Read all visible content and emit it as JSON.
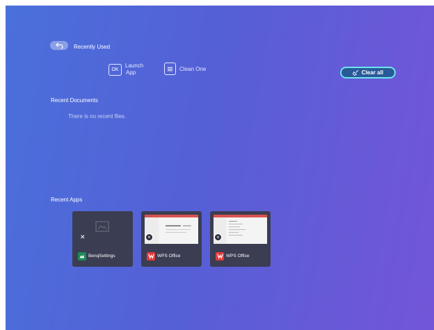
{
  "header": {
    "recently_used_label": "Recently Used"
  },
  "hints": {
    "launch_key": "OK",
    "launch_label_line1": "Launch",
    "launch_label_line2": "App",
    "clean_label": "Clean One"
  },
  "clear_all": {
    "label": "Clear all"
  },
  "recent_documents": {
    "title": "Recent Documents",
    "empty_text": "There is no recent files."
  },
  "recent_apps": {
    "title": "Recent Apps",
    "items": [
      {
        "label": "BenqSettings",
        "icon": "benq-settings-icon",
        "color": "#1f8a5b"
      },
      {
        "label": "WPS Office",
        "icon": "wps-office-icon",
        "color": "#e23b3b"
      },
      {
        "label": "WPS Office",
        "icon": "wps-office-icon",
        "color": "#e23b3b"
      }
    ]
  }
}
